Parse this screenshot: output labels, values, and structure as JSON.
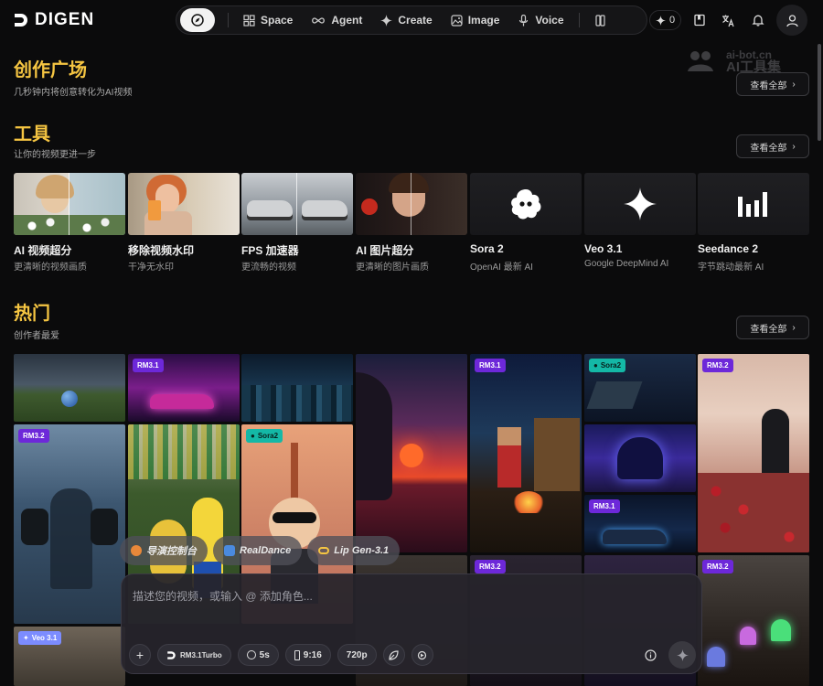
{
  "app": {
    "logo": "DIGEN"
  },
  "nav": {
    "items": [
      {
        "label": "Space",
        "icon": "grid-icon"
      },
      {
        "label": "Agent",
        "icon": "infinity-icon"
      },
      {
        "label": "Create",
        "icon": "sparkle-icon"
      },
      {
        "label": "Image",
        "icon": "image-icon"
      },
      {
        "label": "Voice",
        "icon": "mic-icon"
      }
    ],
    "credits": "0"
  },
  "watermark": {
    "line1": "ai-bot.cn",
    "line2": "AI工具集"
  },
  "sections": {
    "create": {
      "title": "创作广场",
      "subtitle": "几秒钟内将创意转化为AI视频",
      "see_all": "查看全部"
    },
    "tools": {
      "title": "工具",
      "subtitle": "让你的视频更进一步",
      "see_all": "查看全部"
    },
    "hot": {
      "title": "热门",
      "subtitle": "创作者最爱",
      "see_all": "查看全部"
    }
  },
  "tools": [
    {
      "name": "AI 视频超分",
      "desc": "更清晰的视频画质"
    },
    {
      "name": "移除视频水印",
      "desc": "干净无水印"
    },
    {
      "name": "FPS 加速器",
      "desc": "更流畅的视频"
    },
    {
      "name": "AI 图片超分",
      "desc": "更清晰的图片画质"
    },
    {
      "name": "Sora 2",
      "desc": "OpenAI 最新 AI"
    },
    {
      "name": "Veo 3.1",
      "desc": "Google DeepMind AI"
    },
    {
      "name": "Seedance 2",
      "desc": "字节跳动最新 AI"
    }
  ],
  "gallery_badges": {
    "rm31": "RM3.1",
    "rm32": "RM3.2",
    "sora2": "Sora2",
    "veo31": "Veo 3.1"
  },
  "composer": {
    "chips": [
      "导演控制台",
      "RealDance",
      "Lip Gen-3.1"
    ],
    "placeholder": "描述您的视频，或输入 @ 添加角色...",
    "model": "RM3.1Turbo",
    "duration": "5s",
    "ratio": "9:16",
    "resolution": "720p"
  },
  "colors": {
    "accent": "#f5c542",
    "badge_rm": "#6d28d9",
    "badge_sora": "#14b8a6",
    "badge_veo": "#7c8cff"
  }
}
